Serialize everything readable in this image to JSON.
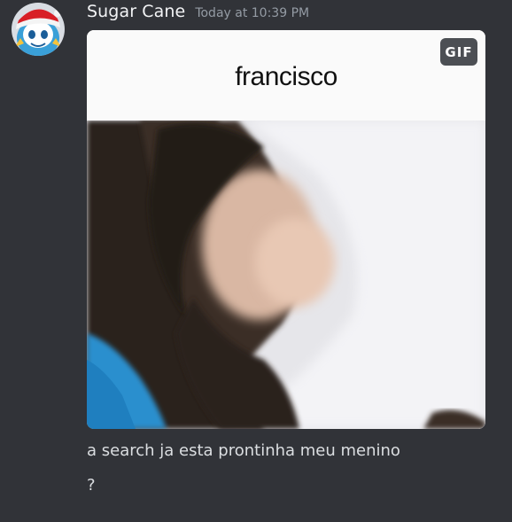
{
  "message": {
    "author": "Sugar Cane",
    "timestamp": "Today at 10:39 PM",
    "avatar_icon": "santa-hat-avatar-icon",
    "gif": {
      "caption": "francisco",
      "badge": "GIF"
    },
    "text_lines": [
      "a search ja esta prontinha meu menino",
      "?"
    ]
  },
  "colors": {
    "background": "#313338",
    "username": "#f2f3f5",
    "timestamp": "#949ba4",
    "message_text": "#dbdee1",
    "gif_badge_bg": "#43464c"
  }
}
